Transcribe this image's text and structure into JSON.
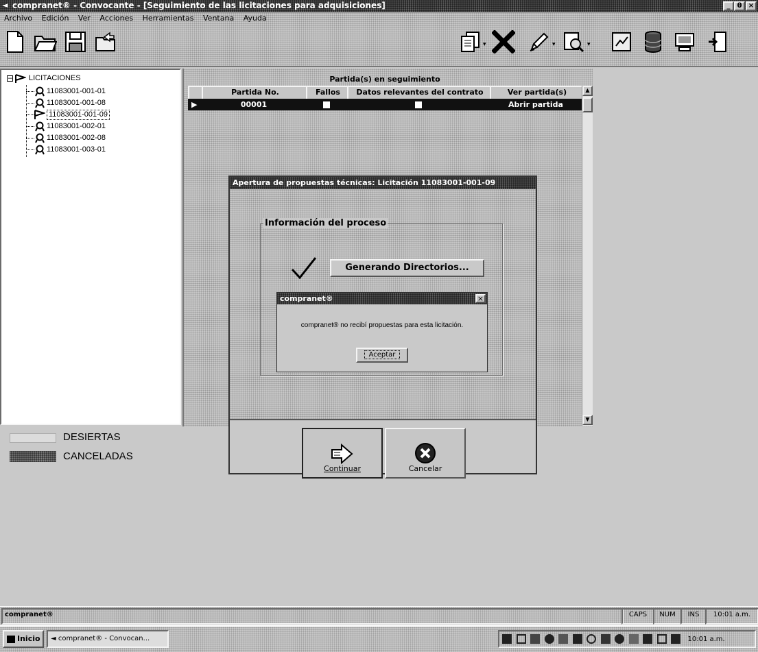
{
  "window": {
    "title": "compranet® - Convocante - [Seguimiento de las licitaciones para adquisiciones]",
    "controls": [
      "_",
      "θ",
      "×"
    ]
  },
  "menu": [
    "Archivo",
    "Edición",
    "Ver",
    "Acciones",
    "Herramientas",
    "Ventana",
    "Ayuda"
  ],
  "tree": {
    "root": "LICITACIONES",
    "items": [
      "11083001-001-01",
      "11083001-001-08",
      "11083001-001-09",
      "11083001-002-01",
      "11083001-002-08",
      "11083001-003-01"
    ],
    "selected_index": 2
  },
  "legend": {
    "desiertas": "DESIERTAS",
    "canceladas": "CANCELADAS"
  },
  "grid": {
    "title": "Partida(s) en seguimiento",
    "columns": [
      "Partida No.",
      "Fallos",
      "Datos relevantes del contrato",
      "Ver partida(s)"
    ],
    "rows": [
      {
        "partida": "00001",
        "action": "Abrir partida"
      }
    ]
  },
  "dialog": {
    "title": "Apertura de propuestas técnicas: Licitación 11083001-001-09",
    "group_label": "Información del proceso",
    "step_label": "Generando Directorios...",
    "continuar": "Continuar",
    "cancelar": "Cancelar"
  },
  "message_box": {
    "title": "compranet®",
    "text": "compranet® no recibí propuestas para esta licitación.",
    "ok": "Aceptar",
    "close": "×"
  },
  "statusbar": {
    "app": "compranet®",
    "caps": "CAPS",
    "num": "NUM",
    "ins": "INS",
    "time": "10:01 a.m."
  },
  "taskbar": {
    "start": "Inicio",
    "task": "compranet® - Convocan...",
    "time": "10:01 a.m."
  }
}
